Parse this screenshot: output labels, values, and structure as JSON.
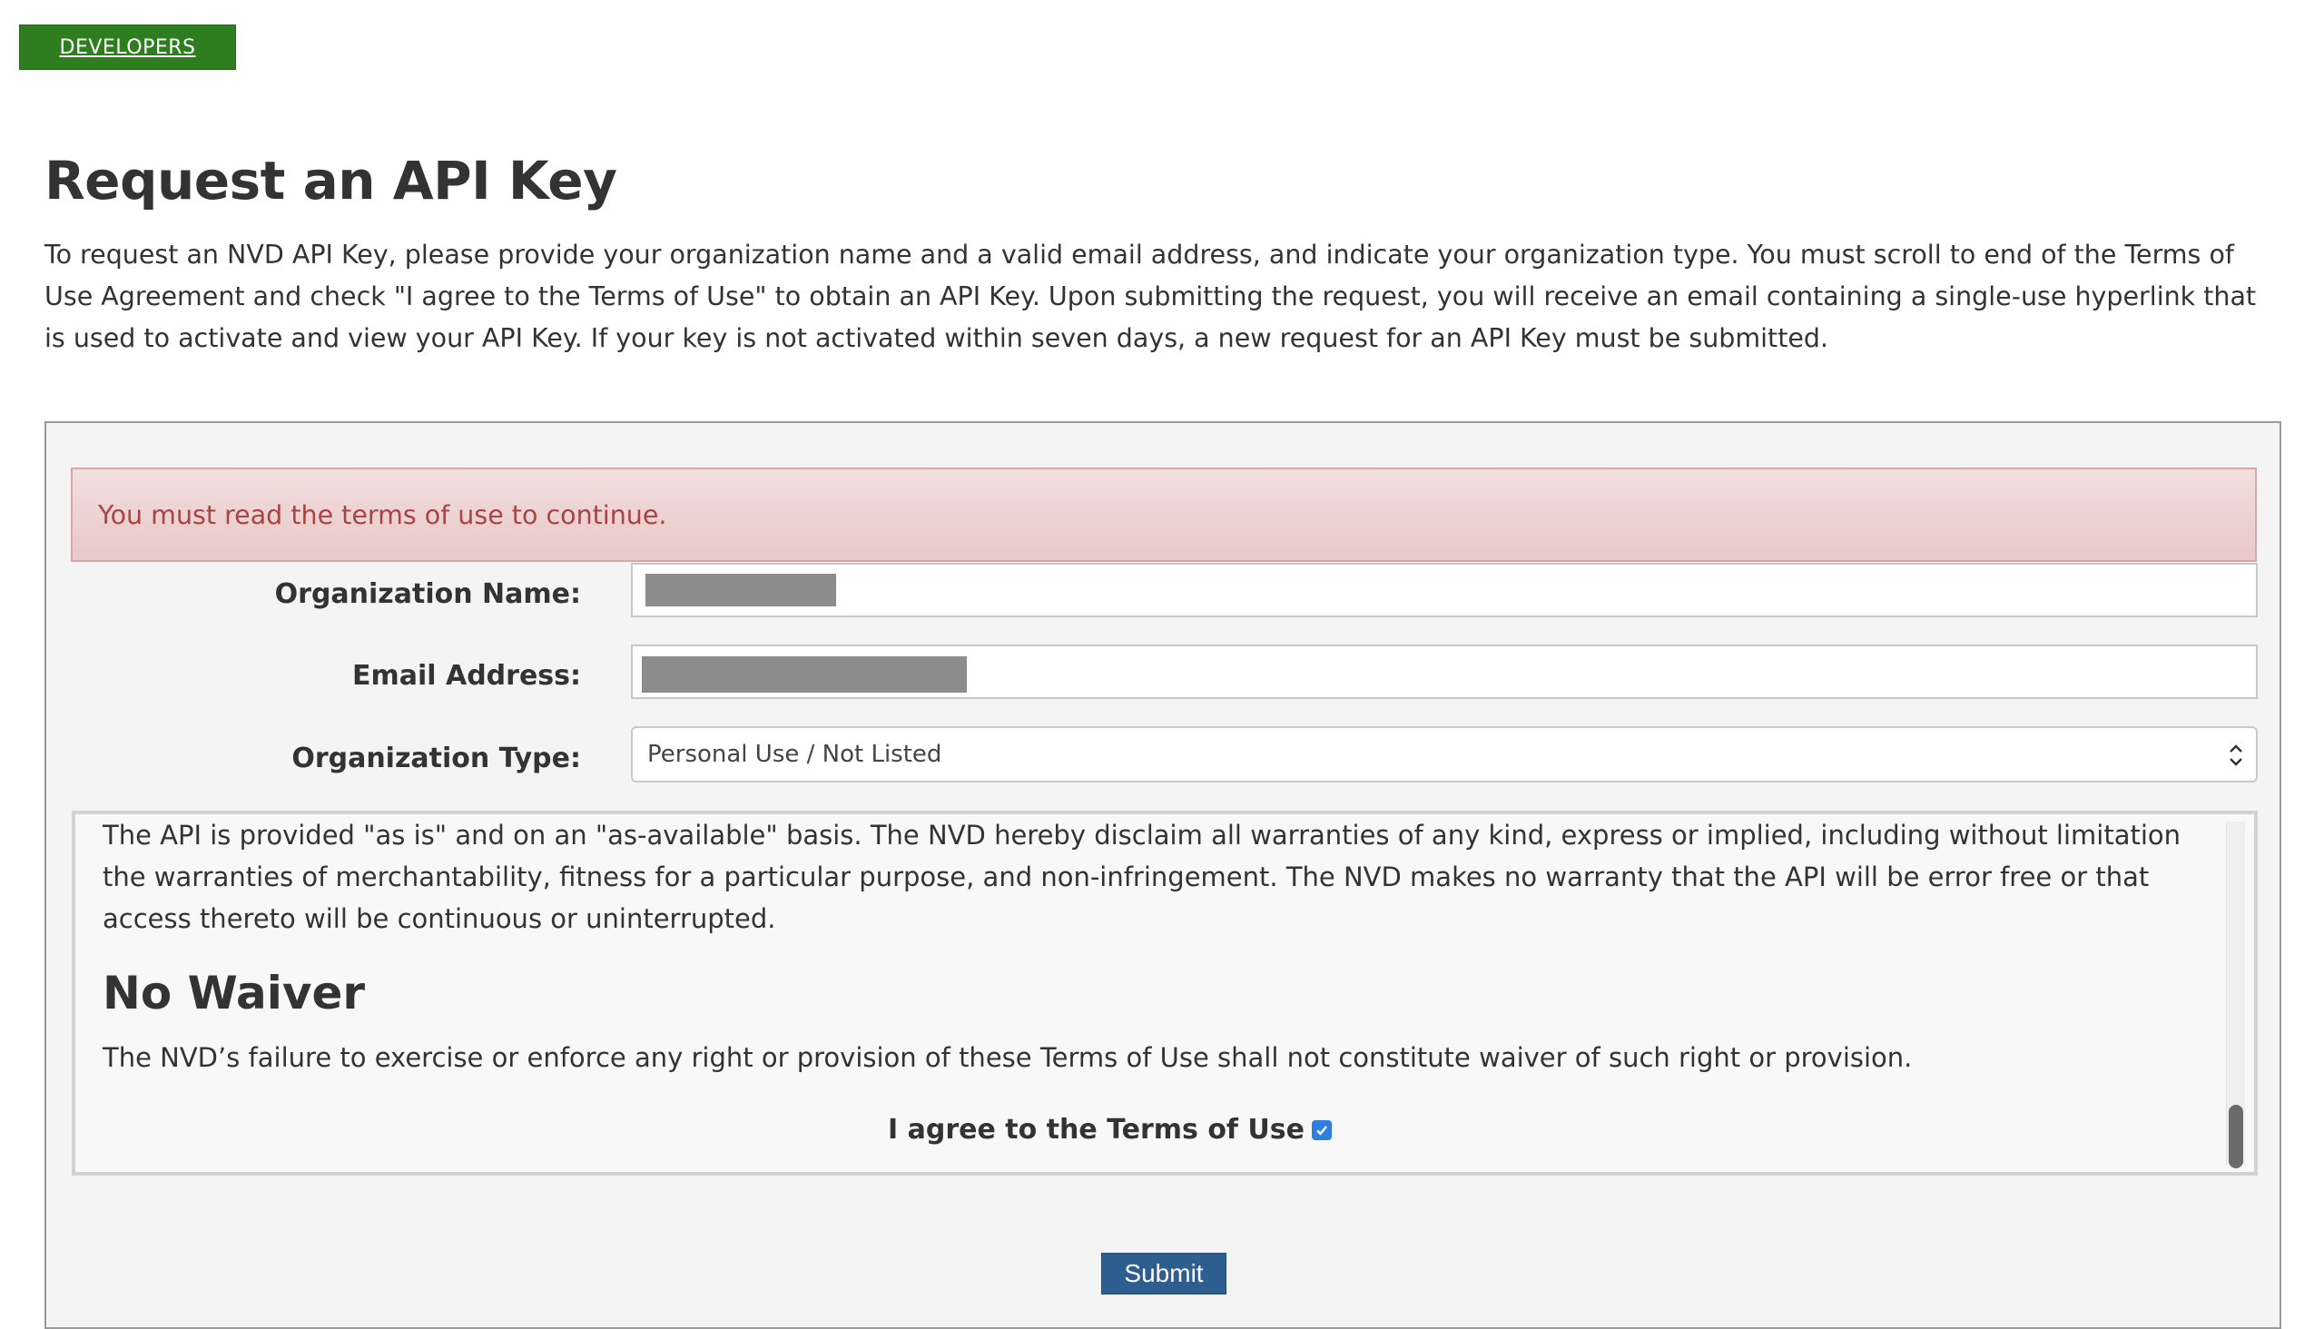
{
  "nav": {
    "developers_label": "DEVELOPERS"
  },
  "page": {
    "title": "Request an API Key",
    "intro": "To request an NVD API Key, please provide your organization name and a valid email address, and indicate your organization type. You must scroll to end of the Terms of Use Agreement and check \"I agree to the Terms of Use\" to obtain an API Key. Upon submitting the request, you will receive an email containing a single-use hyperlink that is used to activate and view your API Key. If your key is not activated within seven days, a new request for an API Key must be submitted."
  },
  "alert": {
    "message": "You must read the terms of use to continue."
  },
  "form": {
    "org_name_label": "Organization Name:",
    "email_label": "Email Address:",
    "org_type_label": "Organization Type:",
    "org_type_value": "Personal Use / Not Listed"
  },
  "terms": {
    "paragraph_1": "The API is provided \"as is\" and on an \"as-available\" basis. The NVD hereby disclaim all warranties of any kind, express or implied, including without limitation the warranties of merchantability, fitness for a particular purpose, and non-infringement. The NVD makes no warranty that the API will be error free or that access thereto will be continuous or uninterrupted.",
    "heading_no_waiver": "No Waiver",
    "paragraph_2": "The NVD’s failure to exercise or enforce any right or provision of these Terms of Use shall not constitute waiver of such right or provision.",
    "agree_label": "I agree to the Terms of Use",
    "agree_checked": true
  },
  "submit_label": "Submit",
  "colors": {
    "developers_tab": "#2e7d1f",
    "alert_bg": "#f2dede",
    "alert_text": "#a94442",
    "submit_bg": "#2e5e8f",
    "checkbox": "#2f7fe0"
  },
  "icons": {
    "select_chevron": "chevron-up-down-icon",
    "checkbox": "checkmark-icon"
  }
}
